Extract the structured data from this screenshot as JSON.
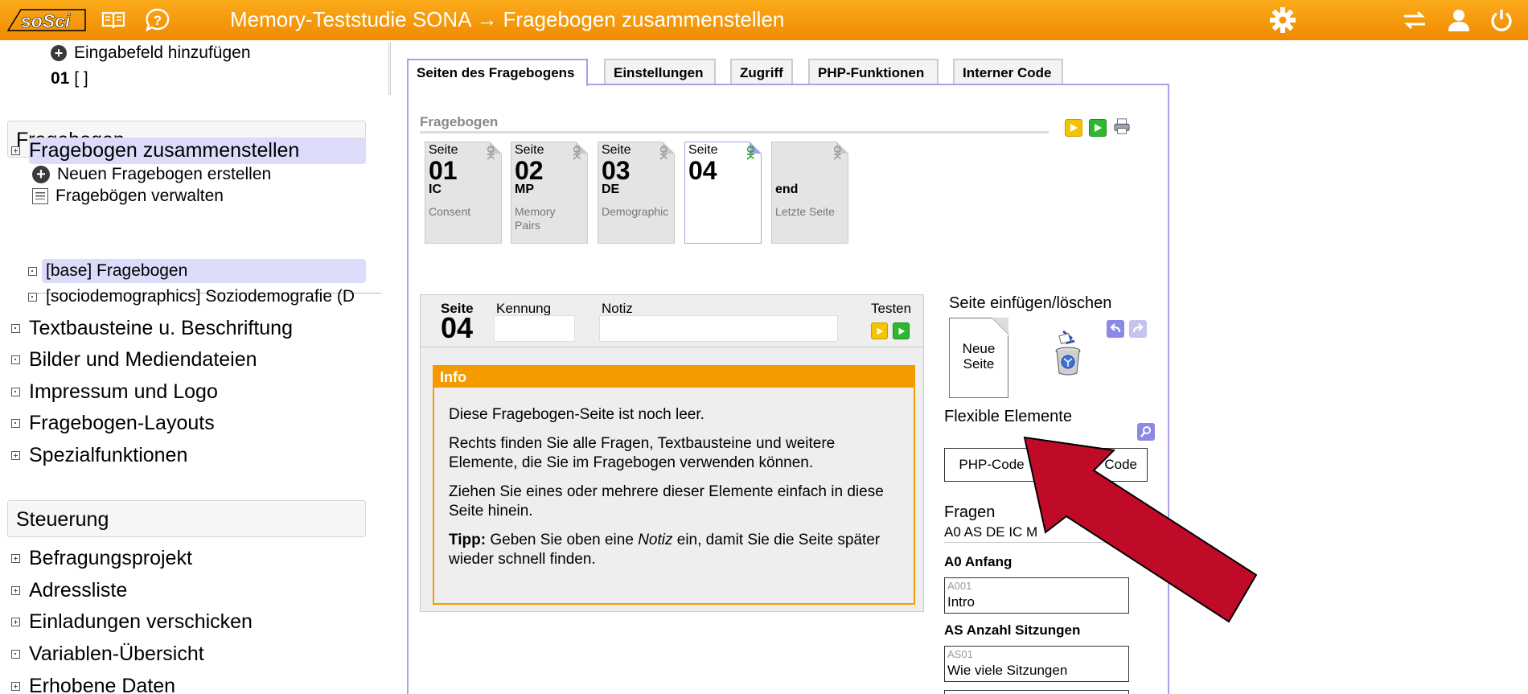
{
  "header": {
    "logo_text": "soSci",
    "title": "Memory-Teststudie SONA → Fragebogen zusammenstellen"
  },
  "sidebar": {
    "add_field": "Eingabefeld hinzufügen",
    "field_num": "01",
    "field_val": "[ ]",
    "section_fragebogen": "Fragebogen",
    "items_fb": [
      "Fragebogen zusammenstellen",
      "Neuen Fragebogen erstellen",
      "Fragebögen verwalten",
      "[base] Fragebogen",
      "[sociodemographics] Soziodemografie (D",
      "Textbausteine u. Beschriftung",
      "Bilder und Mediendateien",
      "Impressum und Logo",
      "Fragebogen-Layouts",
      "Spezialfunktionen"
    ],
    "section_steuerung": "Steuerung",
    "items_st": [
      "Befragungsprojekt",
      "Adressliste",
      "Einladungen verschicken",
      "Variablen-Übersicht",
      "Erhobene Daten"
    ]
  },
  "tabs": [
    "Seiten des Fragebogens",
    "Einstellungen",
    "Zugriff",
    "PHP-Funktionen",
    "Interner Code"
  ],
  "main": {
    "fb_label": "Fragebogen",
    "pages": [
      {
        "seite": "Seite",
        "num": "01",
        "code": "IC",
        "desc": "Consent",
        "ok": "OK"
      },
      {
        "seite": "Seite",
        "num": "02",
        "code": "MP",
        "desc": "Memory Pairs",
        "ok": "OK"
      },
      {
        "seite": "Seite",
        "num": "03",
        "code": "DE",
        "desc": "Demographic",
        "ok": "OK"
      },
      {
        "seite": "Seite",
        "num": "04",
        "code": "",
        "desc": "",
        "ok": "OK"
      },
      {
        "seite": "",
        "num": "",
        "code": "end",
        "desc": "Letzte Seite",
        "ok": "OK"
      }
    ],
    "editor": {
      "seite_label": "Seite",
      "seite_num": "04",
      "kennung_label": "Kennung",
      "notiz_label": "Notiz",
      "testen_label": "Testen",
      "info_title": "Info",
      "p1": "Diese Fragebogen-Seite ist noch leer.",
      "p2": "Rechts finden Sie alle Fragen, Textbausteine und weitere Elemente, die Sie im Fragebogen verwenden können.",
      "p3": "Ziehen Sie eines oder mehrere dieser Elemente einfach in diese Seite hinein.",
      "tip_label": "Tipp:",
      "tip_a": " Geben Sie oben eine ",
      "tip_em": "Notiz",
      "tip_b": " ein, damit Sie die Seite später wieder schnell finden."
    },
    "right": {
      "insert_title": "Seite einfügen/löschen",
      "new_page": "Neue Seite",
      "flex_title": "Flexible Elemente",
      "btn_php": "PHP-Code",
      "btn_code": "Code",
      "fragen_title": "Fragen",
      "fragen_list": "A0 AS DE IC M",
      "g1": "A0 Anfang",
      "q1_id": "A001",
      "q1_txt": "Intro",
      "g2": "AS Anzahl Sitzungen",
      "q2_id": "AS01",
      "q2_txt": "Wie viele Sitzungen"
    }
  },
  "colors": {
    "header": "#f59b00",
    "accent": "#a3a3ee",
    "highlight": "#dcdcfa",
    "arrow": "#c00b28"
  }
}
